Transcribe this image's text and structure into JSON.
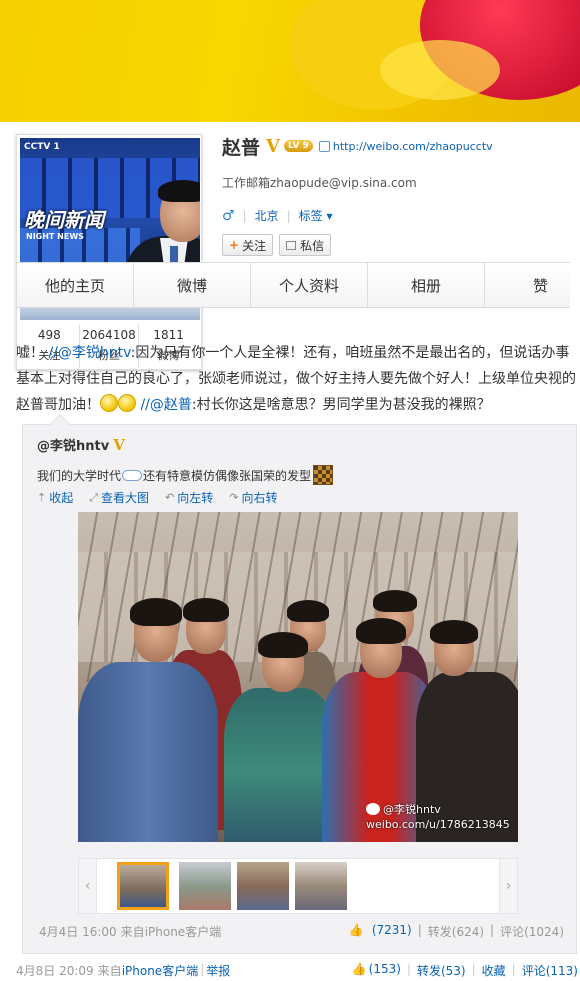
{
  "profile": {
    "name": "赵普",
    "level": "LV 9",
    "homepage_url": "http://weibo.com/zhaopucctv",
    "email_line": "工作邮箱zhaopude@vip.sina.com",
    "gender_symbol": "♂",
    "city": "北京",
    "tags_label": "标签",
    "follow_label": "关注",
    "message_label": "私信",
    "avatar_logo": "晚间新闻",
    "avatar_logo_sub": "NIGHT NEWS",
    "avatar_channel": "CCTV 1",
    "stats": [
      {
        "num": "498",
        "label": "关注"
      },
      {
        "num": "2064108",
        "label": "粉丝"
      },
      {
        "num": "1811",
        "label": "微博"
      }
    ]
  },
  "tabs": [
    "他的主页",
    "微博",
    "个人资料",
    "相册",
    "赞"
  ],
  "post": {
    "text_1": "嘘！",
    "link_1": "//@李锐hntv",
    "text_2": ":因为只有你一个人是全裸！还有，咱班虽然不是最出名的，但说话办事基本上对得住自己的良心了，张颂老师说过，做个好主持人要先做个好人！上级单位央视的赵普哥加油！",
    "link_2": "//@赵普",
    "text_3": ":村长你这是啥意思？男同学里为甚没我的裸照？",
    "time": "4月8日 20:09",
    "source_prefix": "来自",
    "source_app": "iPhone客户端",
    "report": "举报",
    "likes": "(153)",
    "repost": "转发(53)",
    "favorite": "收藏",
    "comment": "评论(113)"
  },
  "repost": {
    "author": "@李锐hntv",
    "text_a": "我们的大学时代",
    "text_b": "还有特意模仿偶像张国荣的发型",
    "actions": [
      {
        "icon": "⇡",
        "label": "收起"
      },
      {
        "icon": "⤢",
        "label": "查看大图"
      },
      {
        "icon": "↶",
        "label": "向左转"
      },
      {
        "icon": "↷",
        "label": "向右转"
      }
    ],
    "watermark_user": "@李锐hntv",
    "watermark_url": "weibo.com/u/1786213845",
    "time": "4月4日 16:00",
    "source_prefix": "来自",
    "source_app": "iPhone客户端",
    "likes": "(7231)",
    "repost": "转发(624)",
    "comment": "评论(1024)"
  }
}
